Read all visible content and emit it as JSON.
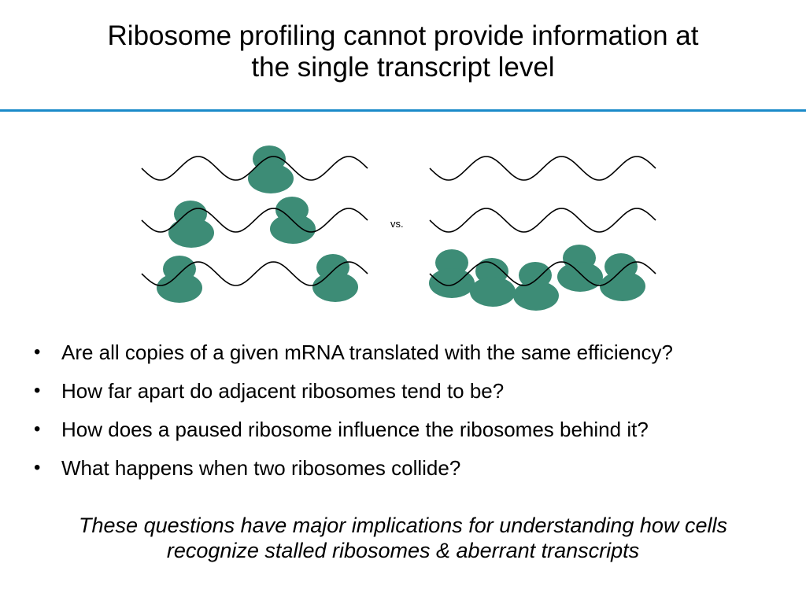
{
  "slide": {
    "title_lines": [
      "Ribosome profiling cannot provide information at",
      "the single transcript level"
    ],
    "accent_color": "#1a8ac9",
    "ribosome_color": "#3d8c76"
  },
  "figure": {
    "vs_label": "vs."
  },
  "bullets": [
    "Are all copies of a given mRNA translated with the same efficiency?",
    "How far apart do adjacent ribosomes tend to be?",
    "How does a paused ribosome influence the ribosomes behind it?",
    "What happens when two ribosomes collide?"
  ],
  "footer_lines": [
    "These questions have major implications for understanding how cells",
    "recognize stalled ribosomes & aberrant transcripts"
  ]
}
